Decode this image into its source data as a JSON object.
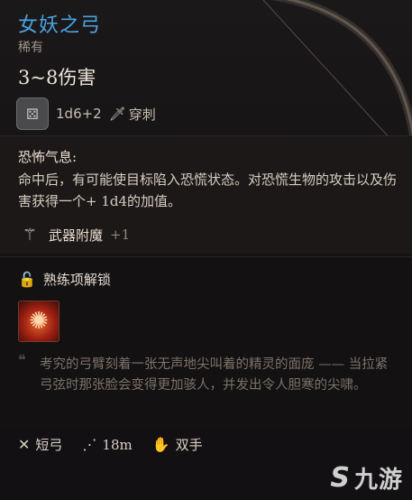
{
  "item": {
    "name": "女妖之弓",
    "rarity": "稀有",
    "damage": "3~8伤害",
    "dice": "1d6+2",
    "damage_type": "穿刺"
  },
  "passive": {
    "title": "恐怖气息:",
    "description": "命中后，有可能使目标陷入恐慌状态。对恐慌生物的攻击以及伤害获得一个+ 1d4的加值。"
  },
  "enchant": {
    "label": "武器附魔",
    "bonus": "+1"
  },
  "proficiency": {
    "label": "熟练项解锁"
  },
  "flavor": {
    "text": "考究的弓臂刻着一张无声地尖叫着的精灵的面庞 —— 当拉紧弓弦时那张脸会变得更加骇人，并发出令人胆寒的尖啸。"
  },
  "properties": {
    "weapon_type": "短弓",
    "range": "18m",
    "handedness": "双手"
  },
  "watermark": {
    "text": "九游"
  },
  "colors": {
    "title": "#4aa3e0",
    "rarity": "#9f968b",
    "flavor": "#7b7369"
  }
}
